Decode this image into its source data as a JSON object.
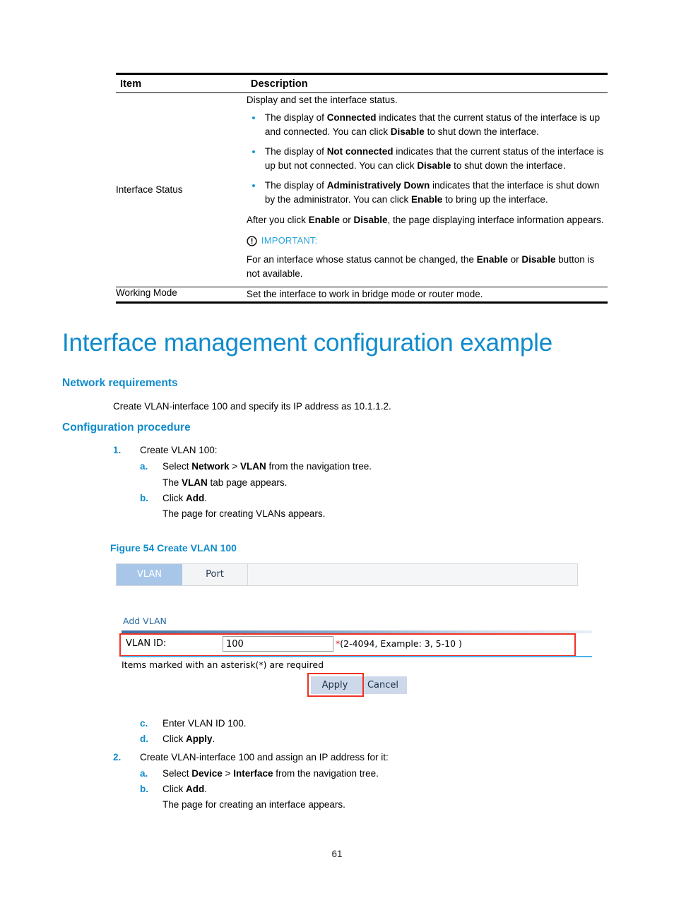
{
  "table": {
    "headers": {
      "item": "Item",
      "description": "Description"
    },
    "rows": [
      {
        "item": "Interface Status",
        "intro": "Display and set the interface status.",
        "bullets": [
          {
            "pre": "The display of ",
            "bold1": "Connected",
            "mid1": " indicates that the current status of the interface is up and connected. You can click ",
            "bold2": "Disable",
            "post": " to shut down the interface."
          },
          {
            "pre": "The display of ",
            "bold1": "Not connected",
            "mid1": " indicates that the current status of the interface is up but not connected. You can click ",
            "bold2": "Disable",
            "post": " to shut down the interface."
          },
          {
            "pre": "The display of ",
            "bold1": "Administratively Down",
            "mid1": " indicates that the interface is shut down by the administrator. You can click ",
            "bold2": "Enable",
            "post": " to bring up the interface."
          }
        ],
        "after_pre": "After you click ",
        "after_bold1": "Enable",
        "after_mid": " or ",
        "after_bold2": "Disable",
        "after_post": ", the page displaying interface information appears.",
        "important_label": "IMPORTANT:",
        "important_pre": "For an interface whose status cannot be changed, the ",
        "important_bold1": "Enable",
        "important_mid": " or ",
        "important_bold2": "Disable",
        "important_post": " button is not available."
      },
      {
        "item": "Working Mode",
        "description": "Set the interface to work in bridge mode or router mode."
      }
    ]
  },
  "headings": {
    "title": "Interface management configuration example",
    "network_requirements": "Network requirements",
    "configuration_procedure": "Configuration procedure"
  },
  "network_requirements_text": "Create VLAN-interface 100 and specify its IP address as 10.1.1.2.",
  "procedure": {
    "step1": {
      "marker": "1.",
      "text": "Create VLAN 100:",
      "substeps": [
        {
          "marker": "a.",
          "pre": "Select ",
          "bold1": "Network",
          "mid": " > ",
          "bold2": "VLAN",
          "post": " from the navigation tree.",
          "continuation_pre": "The ",
          "continuation_bold": "VLAN",
          "continuation_post": " tab page appears."
        },
        {
          "marker": "b.",
          "pre": "Click ",
          "bold1": "Add",
          "mid": "",
          "bold2": "",
          "post": ".",
          "continuation_pre": "The page for creating VLANs appears.",
          "continuation_bold": "",
          "continuation_post": ""
        }
      ]
    },
    "step2": {
      "marker": "2.",
      "text": "Create VLAN-interface 100 and assign an IP address for it:",
      "pre_substeps": [
        {
          "marker": "c.",
          "pre": "Enter VLAN ID 100.",
          "bold1": "",
          "post": ""
        },
        {
          "marker": "d.",
          "pre": "Click ",
          "bold1": "Apply",
          "post": "."
        }
      ],
      "substeps": [
        {
          "marker": "a.",
          "pre": "Select ",
          "bold1": "Device",
          "mid": " > ",
          "bold2": "Interface",
          "post": " from the navigation tree.",
          "continuation": ""
        },
        {
          "marker": "b.",
          "pre": "Click ",
          "bold1": "Add",
          "mid": "",
          "bold2": "",
          "post": ".",
          "continuation": "The page for creating an interface appears."
        }
      ]
    }
  },
  "figure": {
    "caption": "Figure 54 Create VLAN 100",
    "tabs": [
      {
        "label": "VLAN",
        "active": true
      },
      {
        "label": "Port",
        "active": false
      }
    ],
    "section_title": "Add VLAN",
    "field_label": "VLAN ID:",
    "field_value": "100",
    "field_asterisk": "*",
    "field_hint": "(2-4094, Example: 3, 5-10 )",
    "required_note": "Items marked with an asterisk(*) are required",
    "apply_button": "Apply",
    "cancel_button": "Cancel"
  },
  "page_number": "61",
  "colors": {
    "heading_blue": "#0f8bcc",
    "bullet_blue": "#1b9ad6",
    "important_blue": "#29a3dc",
    "annotation_red": "#ef3124",
    "tab_active_bg": "#a7c6e8",
    "button_bg": "#cdd9ea",
    "divider_blue": "#4ab4e8"
  }
}
